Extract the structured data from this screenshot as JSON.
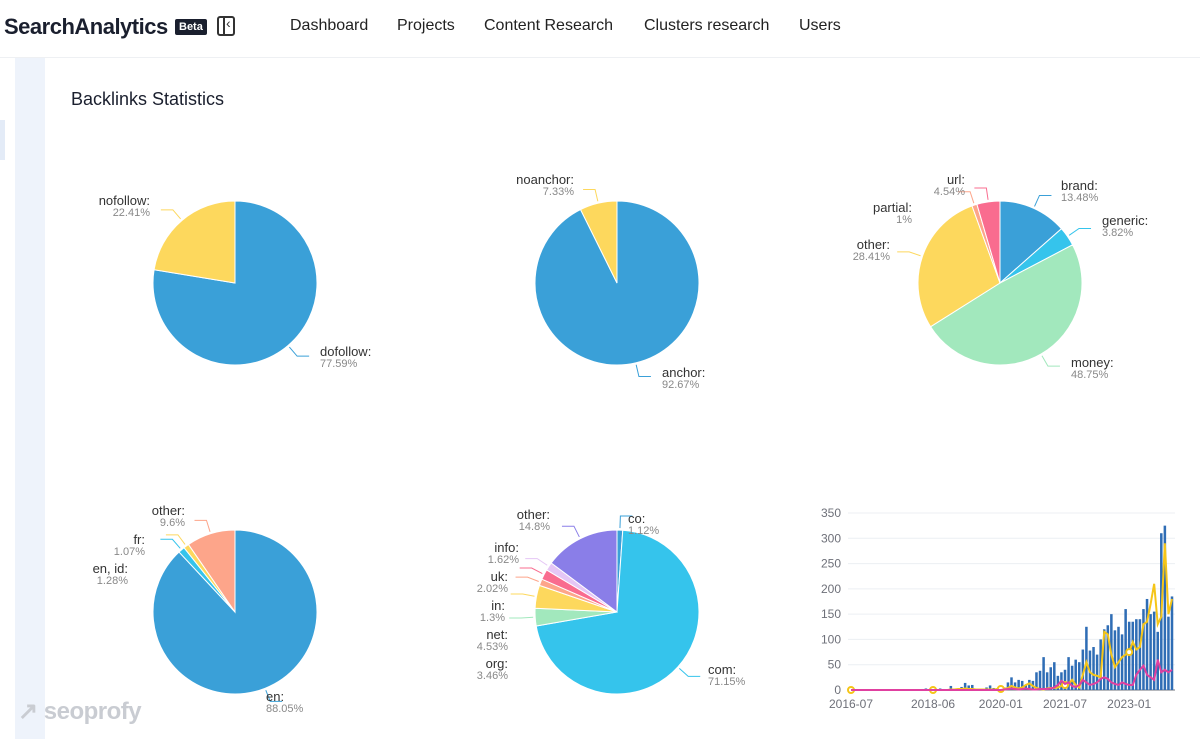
{
  "header": {
    "logo": "SearchAnalytics",
    "badge": "Beta",
    "nav": [
      "Dashboard",
      "Projects",
      "Content Research",
      "Clusters research",
      "Users"
    ]
  },
  "page": {
    "title": "Backlinks Statistics",
    "watermark": "seoprofy"
  },
  "pies": [
    {
      "name": "follow",
      "slices": [
        {
          "label": "dofollow:",
          "pct": "77.59%",
          "value": 77.59,
          "color": "#3aa0d8"
        },
        {
          "label": "nofollow:",
          "pct": "22.41%",
          "value": 22.41,
          "color": "#fdd85d"
        }
      ]
    },
    {
      "name": "anchor",
      "slices": [
        {
          "label": "anchor:",
          "pct": "92.67%",
          "value": 92.67,
          "color": "#3aa0d8"
        },
        {
          "label": "noanchor:",
          "pct": "7.33%",
          "value": 7.33,
          "color": "#fdd85d"
        }
      ]
    },
    {
      "name": "anchor-type",
      "slices": [
        {
          "label": "brand:",
          "pct": "13.48%",
          "value": 13.48,
          "color": "#3aa0d8"
        },
        {
          "label": "generic:",
          "pct": "3.82%",
          "value": 3.82,
          "color": "#35c4ec"
        },
        {
          "label": "money:",
          "pct": "48.75%",
          "value": 48.75,
          "color": "#a2e8bd"
        },
        {
          "label": "other:",
          "pct": "28.41%",
          "value": 28.41,
          "color": "#fdd85d"
        },
        {
          "label": "partial:",
          "pct": "1%",
          "value": 1,
          "color": "#fda58a"
        },
        {
          "label": "url:",
          "pct": "4.54%",
          "value": 4.54,
          "color": "#f96c8f"
        }
      ]
    },
    {
      "name": "language",
      "slices": [
        {
          "label": "en:",
          "pct": "88.05%",
          "value": 88.05,
          "color": "#3aa0d8"
        },
        {
          "label": "en, id:",
          "pct": "1.28%",
          "value": 1.28,
          "color": "#35c4ec"
        },
        {
          "label": "fr:",
          "pct": "1.07%",
          "value": 1.07,
          "color": "#fdd85d"
        },
        {
          "label": "other:",
          "pct": "9.6%",
          "value": 9.6,
          "color": "#fda58a"
        }
      ]
    },
    {
      "name": "tld",
      "slices": [
        {
          "label": "co:",
          "pct": "1.12%",
          "value": 1.12,
          "color": "#3aa0d8"
        },
        {
          "label": "com:",
          "pct": "71.15%",
          "value": 71.15,
          "color": "#35c4ec"
        },
        {
          "label": "org:",
          "pct": "3.46%",
          "value": 3.46,
          "color": "#a2e8bd"
        },
        {
          "label": "net:",
          "pct": "4.53%",
          "value": 4.53,
          "color": "#fdd85d"
        },
        {
          "label": "in:",
          "pct": "1.3%",
          "value": 1.3,
          "color": "#fda58a"
        },
        {
          "label": "uk:",
          "pct": "2.02%",
          "value": 2.02,
          "color": "#f96c8f"
        },
        {
          "label": "info:",
          "pct": "1.62%",
          "value": 1.62,
          "color": "#e5c6f5"
        },
        {
          "label": "other:",
          "pct": "14.8%",
          "value": 14.8,
          "color": "#8a7ee8"
        }
      ]
    }
  ],
  "chart_data": {
    "type": "bar",
    "x_start": "2016-07",
    "x_interval": "month",
    "xticks": [
      "2016-07",
      "2018-06",
      "2020-01",
      "2021-07",
      "2023-01"
    ],
    "yticks": [
      "0",
      "50",
      "100",
      "150",
      "200",
      "250",
      "300",
      "350"
    ],
    "ylim": [
      0,
      350
    ],
    "grid": true,
    "bars": {
      "color": "#2f6db5",
      "values": [
        0,
        0,
        0,
        0,
        0,
        0,
        0,
        1,
        0,
        0,
        0,
        0,
        0,
        0,
        0,
        0,
        0,
        0,
        0,
        0,
        2,
        3,
        1,
        0,
        2,
        3,
        2,
        1,
        8,
        3,
        2,
        6,
        14,
        9,
        10,
        2,
        1,
        0,
        5,
        9,
        4,
        2,
        5,
        5,
        15,
        25,
        15,
        20,
        18,
        10,
        20,
        18,
        35,
        38,
        65,
        35,
        45,
        55,
        28,
        35,
        40,
        65,
        48,
        60,
        55,
        80,
        125,
        78,
        85,
        70,
        100,
        120,
        128,
        150,
        118,
        125,
        110,
        160,
        135,
        135,
        140,
        140,
        160,
        180,
        150,
        155,
        115,
        310,
        325,
        145,
        185
      ]
    },
    "series": [
      {
        "color": "#f5c518",
        "values": [
          0,
          0,
          0,
          0,
          0,
          0,
          0,
          0,
          0,
          0,
          0,
          0,
          0,
          0,
          0,
          0,
          0,
          0,
          0,
          0,
          0,
          0,
          0,
          0,
          0,
          0,
          0,
          0,
          1,
          1,
          2,
          2,
          3,
          2,
          2,
          1,
          1,
          1,
          1,
          1,
          1,
          2,
          2,
          2,
          4,
          8,
          5,
          3,
          5,
          10,
          13,
          8,
          4,
          2,
          1,
          3,
          4,
          4,
          5,
          8,
          10,
          12,
          20,
          10,
          5,
          30,
          55,
          35,
          30,
          28,
          25,
          115,
          110,
          70,
          45,
          55,
          65,
          70,
          75,
          95,
          80,
          85,
          130,
          135,
          170,
          210,
          130,
          145,
          290,
          150,
          180
        ]
      },
      {
        "color": "#e040a0",
        "values": [
          0,
          0,
          0,
          0,
          0,
          0,
          0,
          0,
          0,
          0,
          0,
          0,
          0,
          0,
          0,
          0,
          0,
          0,
          0,
          0,
          0,
          0,
          0,
          0,
          0,
          0,
          0,
          0,
          0,
          0,
          0,
          0,
          0,
          0,
          0,
          0,
          0,
          0,
          0,
          0,
          0,
          0,
          0,
          1,
          2,
          3,
          2,
          1,
          2,
          3,
          2,
          1,
          1,
          2,
          2,
          2,
          3,
          5,
          10,
          18,
          12,
          15,
          8,
          6,
          10,
          20,
          15,
          10,
          12,
          15,
          22,
          25,
          22,
          15,
          12,
          10,
          15,
          12,
          10,
          10,
          30,
          40,
          48,
          30,
          25,
          20,
          60,
          35,
          40,
          35,
          40
        ]
      }
    ]
  }
}
